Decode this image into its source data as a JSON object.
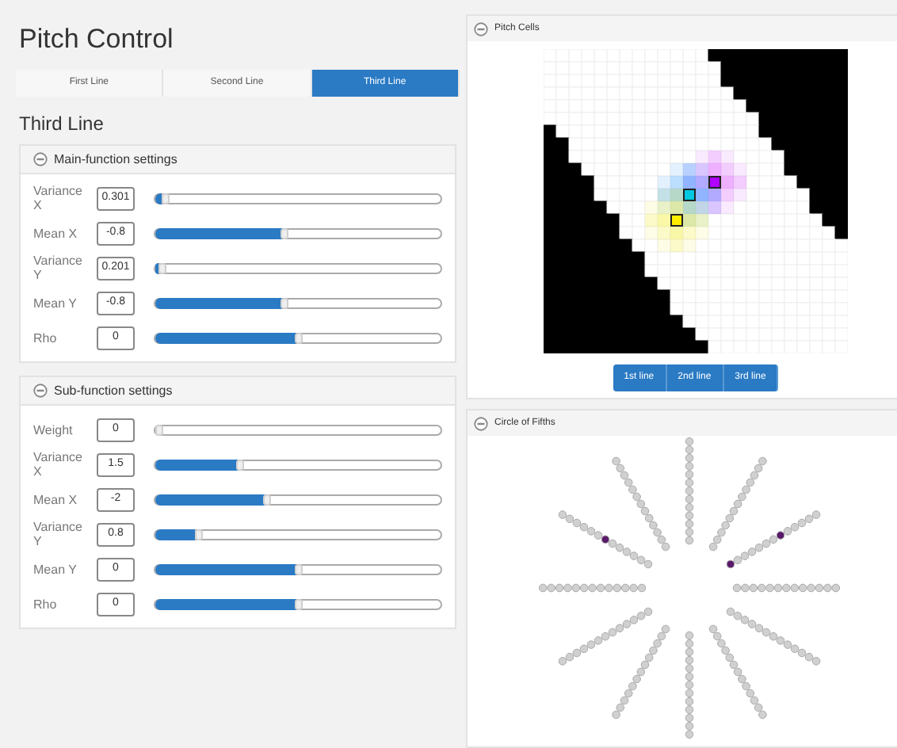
{
  "title": "Pitch Control",
  "tabs": [
    {
      "label": "First Line",
      "selected": false
    },
    {
      "label": "Second Line",
      "selected": false
    },
    {
      "label": "Third Line",
      "selected": true
    }
  ],
  "heading": "Third Line",
  "panels": [
    {
      "title": "Main-function settings",
      "expanded": true,
      "rows": [
        {
          "label": "Variance X",
          "value": "0.301",
          "level": 0.02
        },
        {
          "label": "Mean X",
          "value": "-0.8",
          "level": 0.45
        },
        {
          "label": "Variance Y",
          "value": "0.201",
          "level": 0.01
        },
        {
          "label": "Mean Y",
          "value": "-0.8",
          "level": 0.45
        },
        {
          "label": "Rho",
          "value": "0",
          "level": 0.5
        }
      ]
    },
    {
      "title": "Sub-function settings",
      "expanded": true,
      "rows": [
        {
          "label": "Weight",
          "value": "0",
          "level": 0
        },
        {
          "label": "Variance X",
          "value": "1.5",
          "level": 0.29
        },
        {
          "label": "Mean X",
          "value": "-2",
          "level": 0.39
        },
        {
          "label": "Variance Y",
          "value": "0.8",
          "level": 0.14
        },
        {
          "label": "Mean Y",
          "value": "0",
          "level": 0.5
        },
        {
          "label": "Rho",
          "value": "0",
          "level": 0.5
        }
      ]
    }
  ],
  "pitch_cells": {
    "title": "Pitch Cells",
    "buttons": [
      "1st line",
      "2nd line",
      "3rd line"
    ]
  },
  "circle_of_fifths": {
    "title": "Circle of Fifths"
  }
}
